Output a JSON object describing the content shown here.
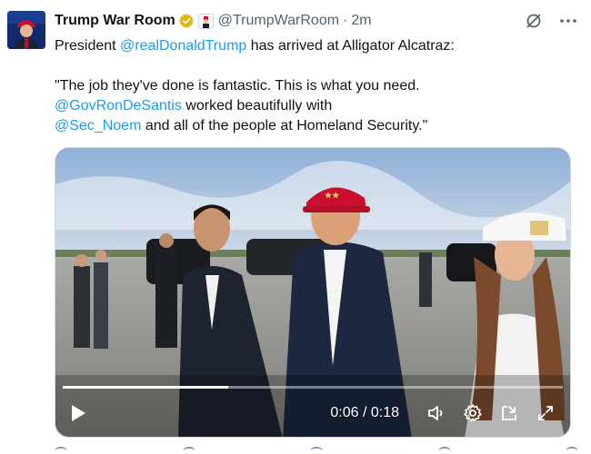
{
  "author": {
    "display_name": "Trump War Room",
    "handle": "@TrumpWarRoom",
    "separator": "·",
    "time": "2m"
  },
  "icons": {
    "verified": "gold-verified-badge-icon",
    "affiliate": "affiliate-badge-icon",
    "grok": "grok-icon",
    "more": "more-options-icon",
    "play": "play-icon",
    "volume": "volume-icon",
    "settings": "settings-gear-icon",
    "pip": "picture-in-picture-icon",
    "fullscreen": "fullscreen-icon"
  },
  "tweet": {
    "line1_prefix": "President ",
    "line1_mention": "@realDonaldTrump",
    "line1_suffix": " has arrived at Alligator Alcatraz:",
    "quote_line1": "\"The job they've done is fantastic. This is what you need.",
    "quote_mention1": "@GovRonDeSantis",
    "quote_line2_suffix": " worked beautifully with",
    "quote_mention2": "@Sec_Noem",
    "quote_line3_suffix": " and all of the people at Homeland Security.\""
  },
  "video": {
    "current_time": "0:06",
    "separator": " / ",
    "duration": "0:18",
    "progress_fraction": 0.33
  },
  "colors": {
    "link": "#1d9bf0",
    "secondary_text": "#536471",
    "verified_gold": "#e2b719"
  }
}
